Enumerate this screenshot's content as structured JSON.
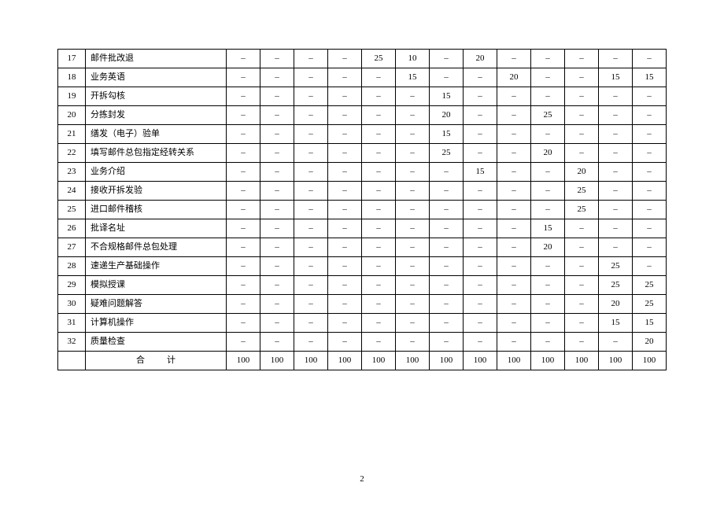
{
  "dash": "–",
  "rows": [
    {
      "idx": "17",
      "name": "邮件批改退",
      "vals": [
        null,
        null,
        null,
        null,
        "25",
        "10",
        null,
        "20",
        null,
        null,
        null,
        null,
        null
      ]
    },
    {
      "idx": "18",
      "name": "业务英语",
      "vals": [
        null,
        null,
        null,
        null,
        null,
        "15",
        null,
        null,
        "20",
        null,
        null,
        "15",
        "15"
      ]
    },
    {
      "idx": "19",
      "name": "开拆勾核",
      "vals": [
        null,
        null,
        null,
        null,
        null,
        null,
        "15",
        null,
        null,
        null,
        null,
        null,
        null
      ]
    },
    {
      "idx": "20",
      "name": "分拣封发",
      "vals": [
        null,
        null,
        null,
        null,
        null,
        null,
        "20",
        null,
        null,
        "25",
        null,
        null,
        null
      ]
    },
    {
      "idx": "21",
      "name": "缮发（电子）验单",
      "vals": [
        null,
        null,
        null,
        null,
        null,
        null,
        "15",
        null,
        null,
        null,
        null,
        null,
        null
      ]
    },
    {
      "idx": "22",
      "name": "填写邮件总包指定经转关系",
      "vals": [
        null,
        null,
        null,
        null,
        null,
        null,
        "25",
        null,
        null,
        "20",
        null,
        null,
        null
      ]
    },
    {
      "idx": "23",
      "name": "业务介绍",
      "vals": [
        null,
        null,
        null,
        null,
        null,
        null,
        null,
        "15",
        null,
        null,
        "20",
        null,
        null
      ]
    },
    {
      "idx": "24",
      "name": "接收开拆发验",
      "vals": [
        null,
        null,
        null,
        null,
        null,
        null,
        null,
        null,
        null,
        null,
        "25",
        null,
        null
      ]
    },
    {
      "idx": "25",
      "name": "进口邮件稽核",
      "vals": [
        null,
        null,
        null,
        null,
        null,
        null,
        null,
        null,
        null,
        null,
        "25",
        null,
        null
      ]
    },
    {
      "idx": "26",
      "name": "批译名址",
      "vals": [
        null,
        null,
        null,
        null,
        null,
        null,
        null,
        null,
        null,
        "15",
        null,
        null,
        null
      ]
    },
    {
      "idx": "27",
      "name": "不合规格邮件总包处理",
      "vals": [
        null,
        null,
        null,
        null,
        null,
        null,
        null,
        null,
        null,
        "20",
        null,
        null,
        null
      ]
    },
    {
      "idx": "28",
      "name": "速递生产基础操作",
      "vals": [
        null,
        null,
        null,
        null,
        null,
        null,
        null,
        null,
        null,
        null,
        null,
        "25",
        null
      ]
    },
    {
      "idx": "29",
      "name": "模拟授课",
      "vals": [
        null,
        null,
        null,
        null,
        null,
        null,
        null,
        null,
        null,
        null,
        null,
        "25",
        "25"
      ]
    },
    {
      "idx": "30",
      "name": "疑难问题解答",
      "vals": [
        null,
        null,
        null,
        null,
        null,
        null,
        null,
        null,
        null,
        null,
        null,
        "20",
        "25"
      ]
    },
    {
      "idx": "31",
      "name": "计算机操作",
      "vals": [
        null,
        null,
        null,
        null,
        null,
        null,
        null,
        null,
        null,
        null,
        null,
        "15",
        "15"
      ]
    },
    {
      "idx": "32",
      "name": "质量检查",
      "vals": [
        null,
        null,
        null,
        null,
        null,
        null,
        null,
        null,
        null,
        null,
        null,
        null,
        "20"
      ]
    }
  ],
  "total": {
    "label": "合计",
    "vals": [
      "100",
      "100",
      "100",
      "100",
      "100",
      "100",
      "100",
      "100",
      "100",
      "100",
      "100",
      "100",
      "100"
    ]
  },
  "page_number": "2",
  "chart_data": {
    "type": "table",
    "columns_count": 13,
    "rows": [
      {
        "row": 17,
        "item": "邮件批改退",
        "c5": 25,
        "c6": 10,
        "c8": 20
      },
      {
        "row": 18,
        "item": "业务英语",
        "c6": 15,
        "c9": 20,
        "c12": 15,
        "c13": 15
      },
      {
        "row": 19,
        "item": "开拆勾核",
        "c7": 15
      },
      {
        "row": 20,
        "item": "分拣封发",
        "c7": 20,
        "c10": 25
      },
      {
        "row": 21,
        "item": "缮发（电子）验单",
        "c7": 15
      },
      {
        "row": 22,
        "item": "填写邮件总包指定经转关系",
        "c7": 25,
        "c10": 20
      },
      {
        "row": 23,
        "item": "业务介绍",
        "c8": 15,
        "c11": 20
      },
      {
        "row": 24,
        "item": "接收开拆发验",
        "c11": 25
      },
      {
        "row": 25,
        "item": "进口邮件稽核",
        "c11": 25
      },
      {
        "row": 26,
        "item": "批译名址",
        "c10": 15
      },
      {
        "row": 27,
        "item": "不合规格邮件总包处理",
        "c10": 20
      },
      {
        "row": 28,
        "item": "速递生产基础操作",
        "c12": 25
      },
      {
        "row": 29,
        "item": "模拟授课",
        "c12": 25,
        "c13": 25
      },
      {
        "row": 30,
        "item": "疑难问题解答",
        "c12": 20,
        "c13": 25
      },
      {
        "row": 31,
        "item": "计算机操作",
        "c12": 15,
        "c13": 15
      },
      {
        "row": 32,
        "item": "质量检查",
        "c13": 20
      }
    ],
    "totals_per_column": [
      100,
      100,
      100,
      100,
      100,
      100,
      100,
      100,
      100,
      100,
      100,
      100,
      100
    ]
  }
}
